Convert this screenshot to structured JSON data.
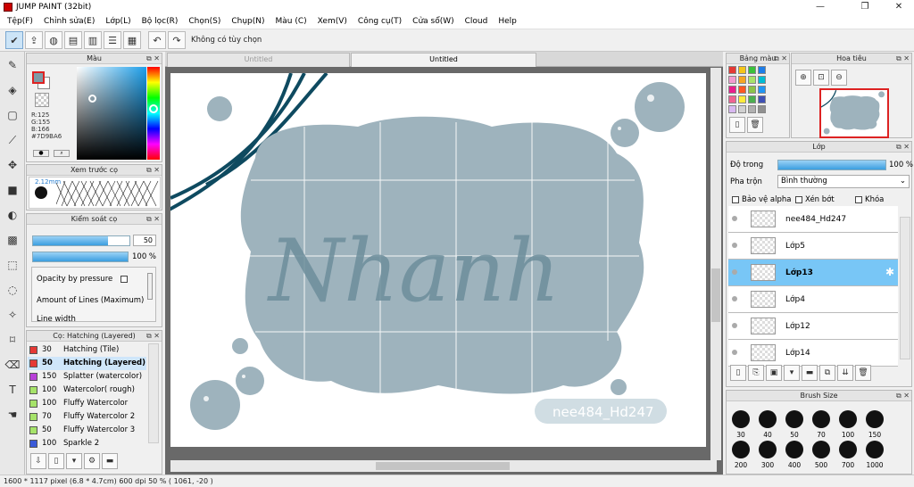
{
  "window": {
    "title": "JUMP PAINT (32bit)",
    "min": "—",
    "max": "❐",
    "close": "✕"
  },
  "menu": [
    "Tệp(F)",
    "Chỉnh sửa(E)",
    "Lớp(L)",
    "Bộ lọc(R)",
    "Chọn(S)",
    "Chụp(N)",
    "Màu (C)",
    "Xem(V)",
    "Công cụ(T)",
    "Cửa sổ(W)",
    "Cloud",
    "Help"
  ],
  "toolbar": {
    "selection_text": "Không có tùy chọn"
  },
  "color_panel": {
    "title": "Màu",
    "r": "R:125",
    "g": "G:155",
    "b": "B:166",
    "hex": "#7D9BA6",
    "main_color": "#7d9ba6"
  },
  "brush_preview": {
    "title": "Xem trước cọ",
    "size_label": "2.12mm"
  },
  "brush_control": {
    "title": "Kiểm soát cọ",
    "size_value": "50",
    "size_fill": 0.78,
    "opacity_value": "100 %",
    "opacity_fill": 1.0,
    "opt1": "Opacity by pressure",
    "opt2": "Amount of Lines (Maximum)",
    "opt3": "Line width"
  },
  "brush_list": {
    "title": "Cọ: Hatching (Layered)",
    "items": [
      {
        "size": "30",
        "name": "Hatching (Tile)",
        "color": "#e53935"
      },
      {
        "size": "50",
        "name": "Hatching (Layered)",
        "color": "#e53935",
        "selected": true
      },
      {
        "size": "150",
        "name": "Splatter (watercolor)",
        "color": "#b83fd8"
      },
      {
        "size": "100",
        "name": "Watercolor( rough)",
        "color": "#a6e36a"
      },
      {
        "size": "100",
        "name": "Fluffy Watercolor",
        "color": "#a6e36a"
      },
      {
        "size": "70",
        "name": "Fluffy Watercolor 2",
        "color": "#a6e36a"
      },
      {
        "size": "50",
        "name": "Fluffy Watercolor 3",
        "color": "#a6e36a"
      },
      {
        "size": "100",
        "name": "Sparkle 2",
        "color": "#3a5ad8"
      }
    ]
  },
  "tabs": [
    "Untitled",
    "Untitled"
  ],
  "canvas": {
    "lettering": "Nhanh",
    "watermark": "nee484_Hd247"
  },
  "swatches": {
    "title": "Bảng màu",
    "colors": [
      "#e53935",
      "#f5c518",
      "#3ac13a",
      "#1e7de8",
      "#f39bd0",
      "#f5a623",
      "#a6e36a",
      "#00bcd4",
      "#e91e8c",
      "#ff5722",
      "#8bc34a",
      "#2196f3",
      "#f06292",
      "#ffeb3b",
      "#4caf50",
      "#3f51b5",
      "#d8b8f0",
      "#d0d0d0",
      "#b0b0b0",
      "#909090"
    ]
  },
  "navigator": {
    "title": "Hoa tiêu"
  },
  "layers": {
    "title": "Lớp",
    "opacity_label": "Độ trong",
    "opacity_value": "100 %",
    "blend_label": "Pha trộn",
    "blend_value": "Bình thường",
    "protect_alpha": "Bảo vệ alpha",
    "clipping": "Xén bớt",
    "lock": "Khóa",
    "items": [
      {
        "name": "nee484_Hd247"
      },
      {
        "name": "Lớp5"
      },
      {
        "name": "Lớp13",
        "selected": true
      },
      {
        "name": "Lớp4"
      },
      {
        "name": "Lớp12"
      },
      {
        "name": "Lớp14"
      }
    ]
  },
  "brush_size": {
    "title": "Brush Size",
    "row1": [
      "30",
      "40",
      "50",
      "70",
      "100",
      "150"
    ],
    "row2": [
      "200",
      "300",
      "400",
      "500",
      "700",
      "1000"
    ]
  },
  "status": {
    "text": "1600 * 1117 pixel   (6.8 * 4.7cm)   600 dpi   50 %   ( 1061, -20 )"
  }
}
